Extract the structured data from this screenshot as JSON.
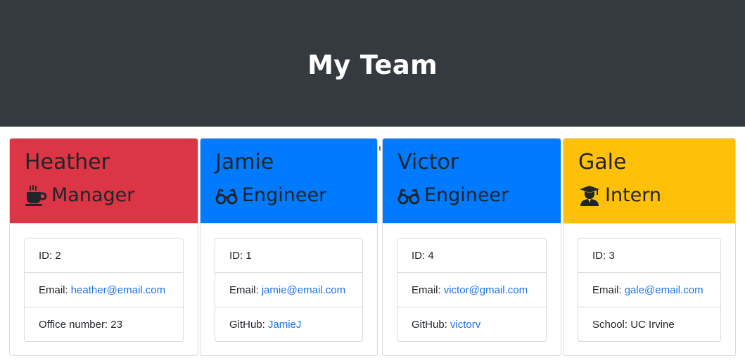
{
  "header": {
    "title": "My Team"
  },
  "colors": {
    "manager": "#dc3545",
    "engineer": "#007bff",
    "intern": "#ffc107",
    "header_bg": "#343a40"
  },
  "employees": [
    {
      "name": "Heather",
      "role": "Manager",
      "icon": "coffee-icon",
      "id_text": "ID: 2",
      "email_label": "Email:",
      "email": "heather@email.com",
      "extra_label": "Office number: 23",
      "extra_value": ""
    },
    {
      "name": "Jamie",
      "role": "Engineer",
      "icon": "glasses-icon",
      "id_text": "ID: 1",
      "email_label": "Email:",
      "email": "jamie@email.com",
      "extra_label": "GitHub:",
      "extra_value": "JamieJ"
    },
    {
      "name": "Victor",
      "role": "Engineer",
      "icon": "glasses-icon",
      "id_text": "ID: 4",
      "email_label": "Email:",
      "email": "victor@gmail.com",
      "extra_label": "GitHub:",
      "extra_value": "victorv"
    },
    {
      "name": "Gale",
      "role": "Intern",
      "icon": "graduate-icon",
      "id_text": "ID: 3",
      "email_label": "Email:",
      "email": "gale@email.com",
      "extra_label": "School: UC Irvine",
      "extra_value": ""
    }
  ]
}
